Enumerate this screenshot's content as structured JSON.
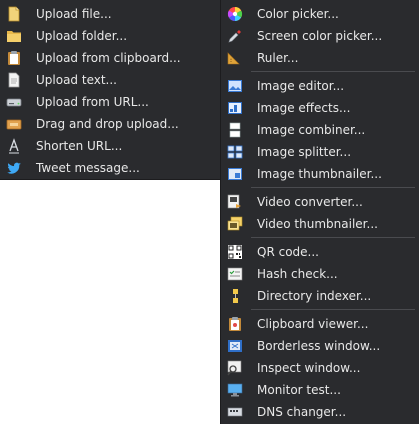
{
  "upload_menu": {
    "items": [
      {
        "label": "Upload file...",
        "icon": "file-icon"
      },
      {
        "label": "Upload folder...",
        "icon": "folder-icon"
      },
      {
        "label": "Upload from clipboard...",
        "icon": "clipboard-icon"
      },
      {
        "label": "Upload text...",
        "icon": "text-document-icon"
      },
      {
        "label": "Upload from URL...",
        "icon": "drive-icon"
      },
      {
        "label": "Drag and drop upload...",
        "icon": "drop-box-icon"
      },
      {
        "label": "Shorten URL...",
        "icon": "shorten-url-icon"
      },
      {
        "label": "Tweet message...",
        "icon": "twitter-bird-icon"
      }
    ]
  },
  "tools_menu": {
    "items": [
      {
        "label": "Color picker...",
        "icon": "color-wheel-icon"
      },
      {
        "label": "Screen color picker...",
        "icon": "eyedropper-icon"
      },
      {
        "label": "Ruler...",
        "icon": "ruler-icon"
      },
      {
        "label": "Image editor...",
        "icon": "image-editor-icon"
      },
      {
        "label": "Image effects...",
        "icon": "image-effects-icon"
      },
      {
        "label": "Image combiner...",
        "icon": "image-combiner-icon"
      },
      {
        "label": "Image splitter...",
        "icon": "image-splitter-icon"
      },
      {
        "label": "Image thumbnailer...",
        "icon": "image-thumbnailer-icon"
      },
      {
        "label": "Video converter...",
        "icon": "video-converter-icon"
      },
      {
        "label": "Video thumbnailer...",
        "icon": "video-thumbnailer-icon"
      },
      {
        "label": "QR code...",
        "icon": "qr-code-icon"
      },
      {
        "label": "Hash check...",
        "icon": "hash-check-icon"
      },
      {
        "label": "Directory indexer...",
        "icon": "directory-indexer-icon"
      },
      {
        "label": "Clipboard viewer...",
        "icon": "clipboard-viewer-icon"
      },
      {
        "label": "Borderless window...",
        "icon": "borderless-window-icon"
      },
      {
        "label": "Inspect window...",
        "icon": "inspect-window-icon"
      },
      {
        "label": "Monitor test...",
        "icon": "monitor-icon"
      },
      {
        "label": "DNS changer...",
        "icon": "dns-icon"
      }
    ]
  },
  "colors": {
    "menu_background": "#2a2b2e",
    "menu_text": "#e8e8e8",
    "separator": "#4a4b4f"
  }
}
